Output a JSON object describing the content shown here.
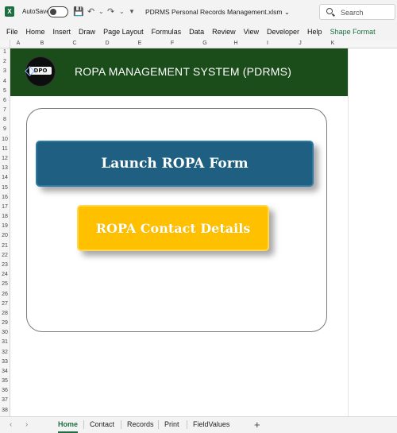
{
  "titlebar": {
    "app_icon": "excel-icon",
    "autosave_label": "AutoSave",
    "autosave_state": "off",
    "document_title": "PDRMS Personal Records Management.xlsm",
    "search_placeholder": "Search"
  },
  "ribbon": {
    "tabs": [
      "File",
      "Home",
      "Insert",
      "Draw",
      "Page Layout",
      "Formulas",
      "Data",
      "Review",
      "View",
      "Developer",
      "Help",
      "Shape Format"
    ]
  },
  "columns": [
    "A",
    "B",
    "C",
    "D",
    "E",
    "F",
    "G",
    "H",
    "I",
    "J",
    "K"
  ],
  "rows": [
    "1",
    "2",
    "3",
    "4",
    "5",
    "6",
    "7",
    "8",
    "9",
    "10",
    "11",
    "12",
    "13",
    "14",
    "15",
    "16",
    "17",
    "18",
    "19",
    "20",
    "21",
    "22",
    "23",
    "24",
    "25",
    "26",
    "27",
    "28",
    "29",
    "30",
    "31",
    "32",
    "33",
    "34",
    "35",
    "36",
    "37",
    "38"
  ],
  "banner": {
    "logo_text": "DPO",
    "title": "ROPA MANAGEMENT SYSTEM (PDRMS)",
    "background_color": "#1b4d1b"
  },
  "buttons": {
    "launch_label": "Launch ROPA Form",
    "launch_color": "#1e5f82",
    "contact_label": "ROPA Contact Details",
    "contact_color": "#ffc000"
  },
  "sheet_tabs": [
    "Home",
    "Contact",
    "Records",
    "Print",
    "FieldValues"
  ],
  "active_sheet": "Home"
}
